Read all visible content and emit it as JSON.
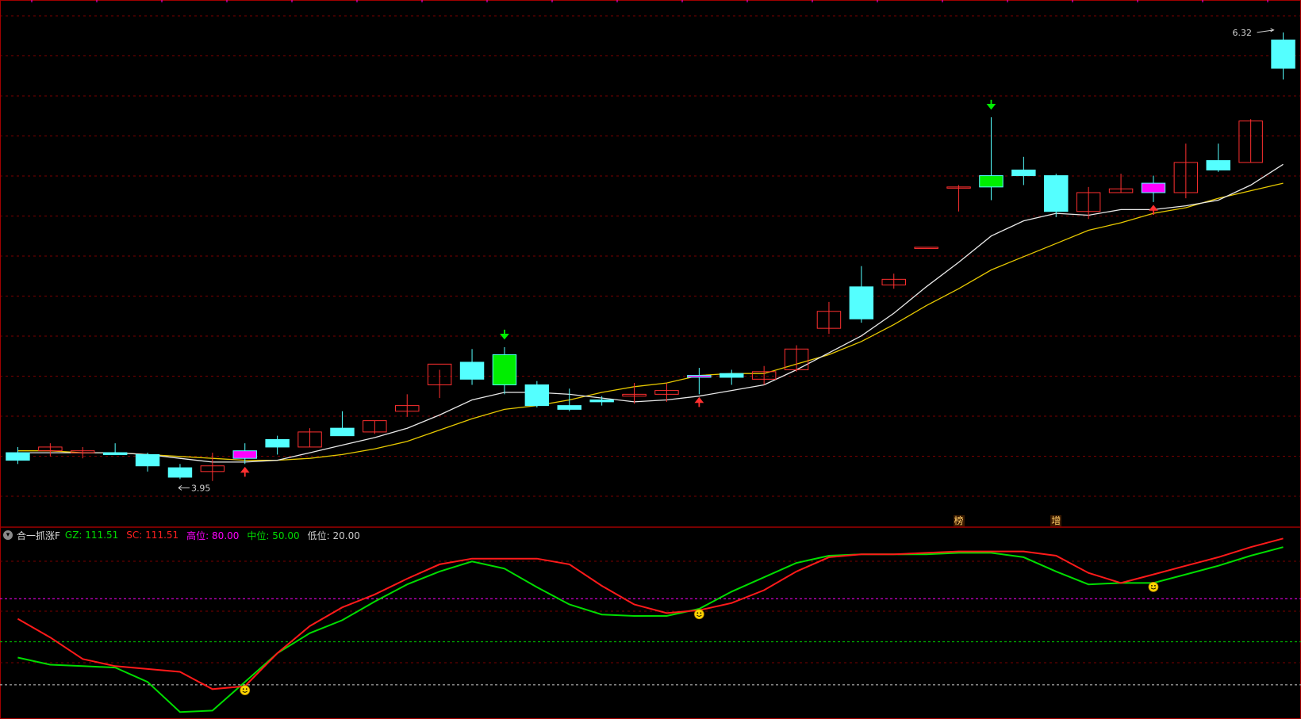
{
  "colors": {
    "background": "#000000",
    "frame": "#a00000",
    "grid": "#7a0000",
    "up": "#ff3030",
    "down": "#54ffff",
    "ma_fast": "#e8e8e8",
    "ma_slow": "#e6c800",
    "signal_magenta": "#ff00ff",
    "signal_green": "#00ee00",
    "gz_line": "#00dd00",
    "sc_line": "#ff1a1a",
    "level_high": "#ff00ff",
    "level_mid": "#00cc00",
    "level_low": "#cccccc",
    "smile": "#ffd400"
  },
  "main": {
    "high_label": "6.32",
    "low_label": "3.95"
  },
  "tags": [
    {
      "text": "榜",
      "candle": 29
    },
    {
      "text": "增",
      "candle": 32
    }
  ],
  "indicator": {
    "name": "合一抓涨F",
    "gz": {
      "label": "GZ:",
      "value": "111.51",
      "color": "#00dd00"
    },
    "sc": {
      "label": "SC:",
      "value": "111.51",
      "color": "#ff2020"
    },
    "high": {
      "label": "高位:",
      "value": "80.00",
      "color": "#ff00ff"
    },
    "mid": {
      "label": "中位:",
      "value": "50.00",
      "color": "#00dd00"
    },
    "low": {
      "label": "低位:",
      "value": "20.00",
      "color": "#cccccc"
    }
  },
  "chart_data": [
    {
      "type": "candlestick",
      "price_range": [
        3.8,
        6.45
      ],
      "candles": [
        {
          "o": 4.09,
          "h": 4.12,
          "l": 4.03,
          "c": 4.05
        },
        {
          "o": 4.1,
          "h": 4.14,
          "l": 4.07,
          "c": 4.12
        },
        {
          "o": 4.09,
          "h": 4.12,
          "l": 4.06,
          "c": 4.1
        },
        {
          "o": 4.09,
          "h": 4.14,
          "l": 4.09,
          "c": 4.08
        },
        {
          "o": 4.08,
          "h": 4.09,
          "l": 3.99,
          "c": 4.02
        },
        {
          "o": 4.01,
          "h": 4.03,
          "l": 3.95,
          "c": 3.96
        },
        {
          "o": 3.99,
          "h": 4.09,
          "l": 3.94,
          "c": 4.02
        },
        {
          "o": 4.1,
          "h": 4.14,
          "l": 4.03,
          "c": 4.06
        },
        {
          "o": 4.16,
          "h": 4.18,
          "l": 4.08,
          "c": 4.12
        },
        {
          "o": 4.12,
          "h": 4.22,
          "l": 4.12,
          "c": 4.2
        },
        {
          "o": 4.22,
          "h": 4.31,
          "l": 4.19,
          "c": 4.18
        },
        {
          "o": 4.2,
          "h": 4.26,
          "l": 4.19,
          "c": 4.26
        },
        {
          "o": 4.31,
          "h": 4.4,
          "l": 4.28,
          "c": 4.34
        },
        {
          "o": 4.45,
          "h": 4.53,
          "l": 4.38,
          "c": 4.56
        },
        {
          "o": 4.57,
          "h": 4.64,
          "l": 4.45,
          "c": 4.48
        },
        {
          "o": 4.61,
          "h": 4.65,
          "l": 4.4,
          "c": 4.45
        },
        {
          "o": 4.45,
          "h": 4.47,
          "l": 4.33,
          "c": 4.34
        },
        {
          "o": 4.34,
          "h": 4.43,
          "l": 4.31,
          "c": 4.32
        },
        {
          "o": 4.37,
          "h": 4.39,
          "l": 4.34,
          "c": 4.36
        },
        {
          "o": 4.39,
          "h": 4.46,
          "l": 4.35,
          "c": 4.4
        },
        {
          "o": 4.4,
          "h": 4.46,
          "l": 4.36,
          "c": 4.42
        },
        {
          "o": 4.5,
          "h": 4.54,
          "l": 4.4,
          "c": 4.49
        },
        {
          "o": 4.51,
          "h": 4.53,
          "l": 4.45,
          "c": 4.49
        },
        {
          "o": 4.48,
          "h": 4.55,
          "l": 4.45,
          "c": 4.52
        },
        {
          "o": 4.53,
          "h": 4.66,
          "l": 4.52,
          "c": 4.64
        },
        {
          "o": 4.75,
          "h": 4.89,
          "l": 4.72,
          "c": 4.84
        },
        {
          "o": 4.97,
          "h": 5.08,
          "l": 4.78,
          "c": 4.8
        },
        {
          "o": 4.98,
          "h": 5.04,
          "l": 4.96,
          "c": 5.01
        },
        {
          "o": 5.18,
          "h": 5.18,
          "l": 5.18,
          "c": 5.18
        },
        {
          "o": 5.5,
          "h": 5.51,
          "l": 5.37,
          "c": 5.5
        },
        {
          "o": 5.56,
          "h": 5.87,
          "l": 5.43,
          "c": 5.5
        },
        {
          "o": 5.59,
          "h": 5.66,
          "l": 5.51,
          "c": 5.56
        },
        {
          "o": 5.56,
          "h": 5.57,
          "l": 5.34,
          "c": 5.37
        },
        {
          "o": 5.37,
          "h": 5.5,
          "l": 5.33,
          "c": 5.47
        },
        {
          "o": 5.47,
          "h": 5.57,
          "l": 5.47,
          "c": 5.49
        },
        {
          "o": 5.52,
          "h": 5.56,
          "l": 5.42,
          "c": 5.47
        },
        {
          "o": 5.47,
          "h": 5.73,
          "l": 5.44,
          "c": 5.63
        },
        {
          "o": 5.64,
          "h": 5.73,
          "l": 5.58,
          "c": 5.59
        },
        {
          "o": 5.63,
          "h": 5.86,
          "l": 5.63,
          "c": 5.85
        },
        {
          "o": 6.28,
          "h": 6.32,
          "l": 6.07,
          "c": 6.13
        }
      ],
      "ma_fast": [
        4.09,
        4.09,
        4.09,
        4.09,
        4.08,
        4.06,
        4.04,
        4.04,
        4.05,
        4.09,
        4.13,
        4.17,
        4.22,
        4.29,
        4.37,
        4.41,
        4.41,
        4.4,
        4.38,
        4.36,
        4.37,
        4.39,
        4.42,
        4.45,
        4.53,
        4.62,
        4.71,
        4.83,
        4.97,
        5.1,
        5.24,
        5.32,
        5.36,
        5.35,
        5.38,
        5.38,
        5.4,
        5.43,
        5.51,
        5.62
      ],
      "ma_slow": [
        4.1,
        4.1,
        4.09,
        4.09,
        4.08,
        4.07,
        4.06,
        4.05,
        4.05,
        4.06,
        4.08,
        4.11,
        4.15,
        4.21,
        4.27,
        4.32,
        4.34,
        4.37,
        4.41,
        4.44,
        4.46,
        4.5,
        4.51,
        4.51,
        4.56,
        4.61,
        4.68,
        4.77,
        4.87,
        4.96,
        5.06,
        5.13,
        5.2,
        5.27,
        5.31,
        5.36,
        5.39,
        5.44,
        5.48,
        5.52
      ],
      "magenta_bars": [
        7,
        21,
        35
      ],
      "green_bars": [
        15,
        30
      ],
      "up_arrows": [
        7,
        21,
        35
      ],
      "down_arrows": [
        15,
        30
      ]
    },
    {
      "type": "line",
      "ylim": [
        0,
        115
      ],
      "levels": [
        80,
        50,
        20
      ],
      "series": [
        {
          "name": "GZ",
          "values": [
            39,
            34,
            33,
            32,
            22,
            1,
            2,
            22,
            42,
            56,
            65,
            78,
            90,
            99,
            106,
            101,
            88,
            76,
            69,
            68,
            68,
            73,
            85,
            95,
            105,
            110,
            111,
            111,
            111,
            112,
            112,
            109,
            99,
            90,
            91,
            91,
            97,
            103,
            110,
            116
          ]
        },
        {
          "name": "SC",
          "values": [
            66,
            53,
            38,
            33,
            31,
            29,
            17,
            19,
            42,
            61,
            74,
            83,
            94,
            104,
            108,
            108,
            108,
            104,
            89,
            76,
            70,
            72,
            77,
            86,
            99,
            109,
            111,
            111,
            112,
            113,
            113,
            113,
            110,
            98,
            91,
            97,
            103,
            109,
            116,
            122
          ]
        }
      ],
      "smile_markers": [
        7,
        21,
        35
      ]
    }
  ]
}
